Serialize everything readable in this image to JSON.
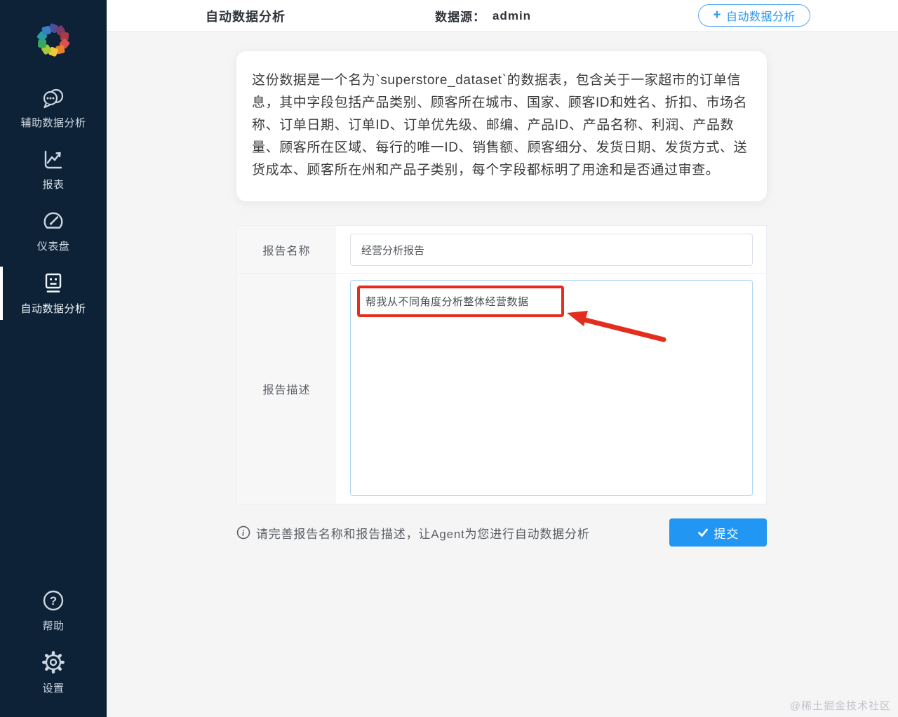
{
  "sidebar": {
    "logo_name": "pinwheel-logo",
    "items": [
      {
        "label": "辅助数据分析",
        "icon": "chat-icon",
        "active": false
      },
      {
        "label": "报表",
        "icon": "line-chart-icon",
        "active": false
      },
      {
        "label": "仪表盘",
        "icon": "gauge-icon",
        "active": false
      },
      {
        "label": "自动数据分析",
        "icon": "robot-icon",
        "active": true
      }
    ],
    "bottom_items": [
      {
        "label": "帮助",
        "icon": "help-icon"
      },
      {
        "label": "设置",
        "icon": "settings-icon"
      }
    ]
  },
  "header": {
    "title": "自动数据分析",
    "datasource_label": "数据源：",
    "datasource_value": "admin",
    "new_button_label": "自动数据分析"
  },
  "description_card": {
    "text": "这份数据是一个名为`superstore_dataset`的数据表，包含关于一家超市的订单信息，其中字段包括产品类别、顾客所在城市、国家、顾客ID和姓名、折扣、市场名称、订单日期、订单ID、订单优先级、邮编、产品ID、产品名称、利润、产品数量、顾客所在区域、每行的唯一ID、销售额、顾客细分、发货日期、发货方式、送货成本、顾客所在州和产品子类别，每个字段都标明了用途和是否通过审查。"
  },
  "form": {
    "name_label": "报告名称",
    "name_value": "经营分析报告",
    "desc_label": "报告描述",
    "desc_value": "帮我从不同角度分析整体经营数据"
  },
  "footer": {
    "hint": "请完善报告名称和报告描述，让Agent为您进行自动数据分析",
    "submit_label": "提交"
  },
  "icons": {
    "plus": "+",
    "check": "✓",
    "question": "?",
    "info": "i"
  },
  "watermark": "@稀土掘金技术社区",
  "colors": {
    "accent_blue": "#2196f3",
    "sidebar_bg": "#0d2237",
    "annotation_red": "#e52d1e",
    "textarea_border": "#a9d4f3"
  }
}
